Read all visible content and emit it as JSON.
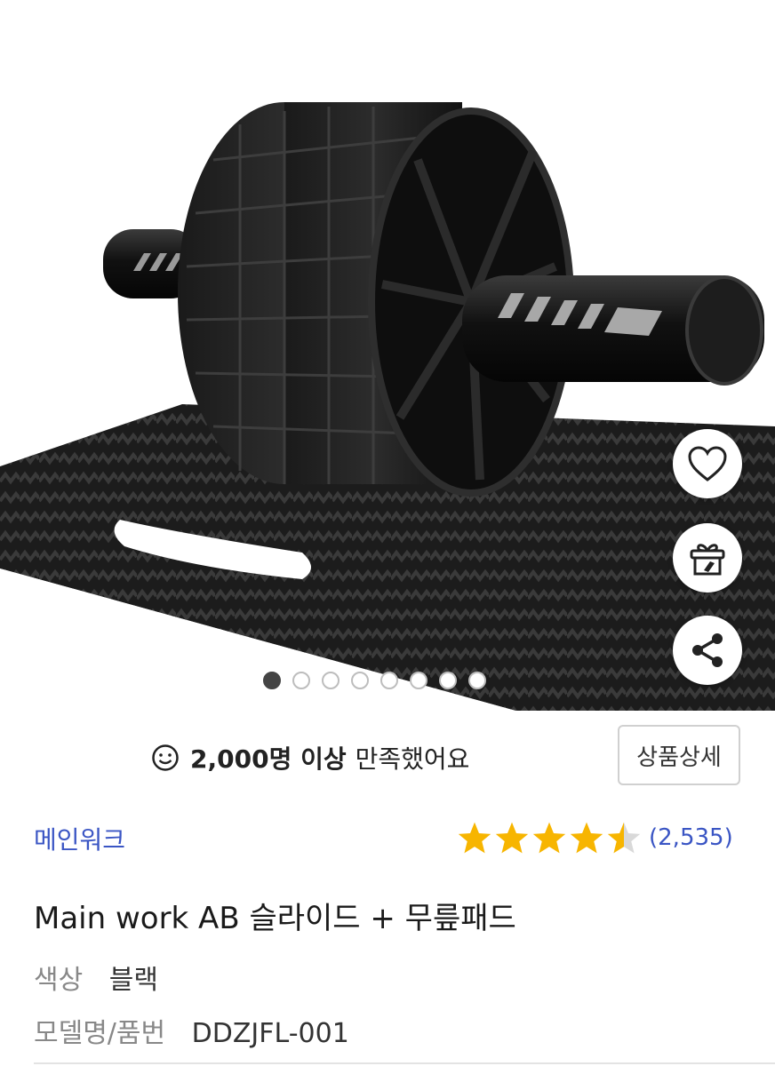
{
  "hero": {
    "image_alt": "AB roller wheel on knee pad",
    "dots_total": 8,
    "dots_active_index": 0,
    "wishlist_icon": "heart-icon",
    "gift_icon": "gift-icon",
    "share_icon": "share-icon"
  },
  "satisfaction": {
    "icon": "smile-icon",
    "count": "2,000명 이상",
    "text": "만족했어요"
  },
  "detail_button": "상품상세",
  "brand": "메인워크",
  "rating": {
    "stars": 4.5,
    "review_count": "(2,535)",
    "star_color": "#f7b500"
  },
  "product": {
    "title": "Main work AB 슬라이드 + 무릎패드",
    "color_label": "색상",
    "color_value": "블랙",
    "model_label": "모델명/품번",
    "model_value": "DDZJFL-001"
  },
  "colors": {
    "accent": "#3a55c4"
  }
}
